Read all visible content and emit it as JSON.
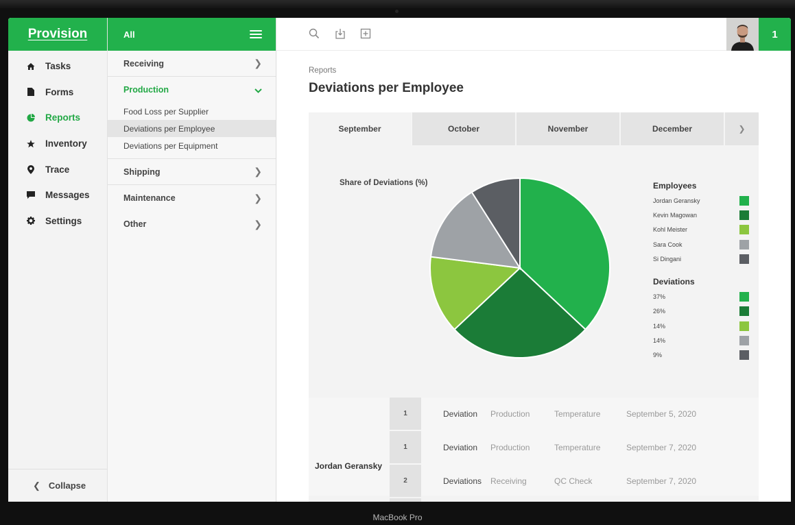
{
  "device_label": "MacBook Pro",
  "brand": {
    "name": "Provision",
    "color": "#22b14c"
  },
  "nav": {
    "items": [
      {
        "label": "Tasks",
        "icon": "home-icon"
      },
      {
        "label": "Forms",
        "icon": "document-icon"
      },
      {
        "label": "Reports",
        "icon": "pie-chart-icon",
        "active": true
      },
      {
        "label": "Inventory",
        "icon": "star-icon"
      },
      {
        "label": "Trace",
        "icon": "location-pin-icon"
      },
      {
        "label": "Messages",
        "icon": "chat-icon"
      },
      {
        "label": "Settings",
        "icon": "gear-icon"
      }
    ],
    "collapse_label": "Collapse"
  },
  "subnav": {
    "header": "All",
    "sections": [
      {
        "label": "Receiving"
      },
      {
        "label": "Production",
        "open": true,
        "children": [
          "Food Loss per Supplier",
          "Deviations per Employee",
          "Deviations per Equipment"
        ],
        "selected": "Deviations per Employee"
      },
      {
        "label": "Shipping"
      },
      {
        "label": "Maintenance"
      },
      {
        "label": "Other"
      }
    ]
  },
  "topbar": {
    "icons": [
      "search-icon",
      "export-icon",
      "add-icon"
    ],
    "notification_count": "1"
  },
  "main": {
    "breadcrumb": "Reports",
    "title": "Deviations per Employee",
    "tabs": [
      "September",
      "October",
      "November",
      "December"
    ],
    "active_tab": "September",
    "chart_title": "Share of Deviations (%)",
    "legend": {
      "employees_heading": "Employees",
      "deviations_heading": "Deviations"
    }
  },
  "chart_data": {
    "type": "pie",
    "title": "Share of Deviations (%)",
    "slices": [
      {
        "label": "Jordan Geransky",
        "value": 37,
        "value_label": "37%",
        "color": "#22b14c"
      },
      {
        "label": "Kevin Magowan",
        "value": 26,
        "value_label": "26%",
        "color": "#1b7c37"
      },
      {
        "label": "Kohl Meister",
        "value": 14,
        "value_label": "14%",
        "color": "#8cc63f"
      },
      {
        "label": "Sara Cook",
        "value": 14,
        "value_label": "14%",
        "color": "#9ea2a6"
      },
      {
        "label": "Si Dingani",
        "value": 9,
        "value_label": "9%",
        "color": "#5b5e63"
      }
    ]
  },
  "table": {
    "employee": "Jordan Geransky",
    "rows": [
      {
        "num": "1",
        "type": "Deviation",
        "area": "Production",
        "check": "Temperature",
        "date": "September 5, 2020"
      },
      {
        "num": "1",
        "type": "Deviation",
        "area": "Production",
        "check": "Temperature",
        "date": "September 7, 2020"
      },
      {
        "num": "2",
        "type": "Deviations",
        "area": "Receiving",
        "check": "QC Check",
        "date": "September 7, 2020"
      }
    ]
  }
}
